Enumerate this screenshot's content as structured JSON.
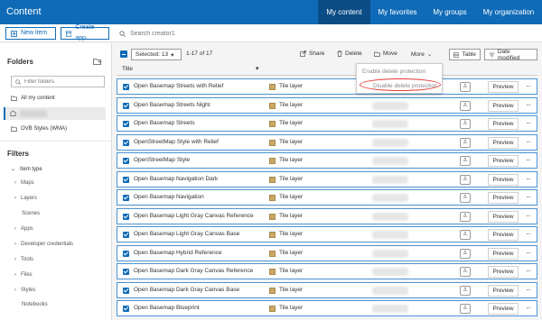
{
  "app": {
    "title": "Content",
    "tabs": [
      {
        "label": "My content",
        "active": true
      },
      {
        "label": "My favorites",
        "active": false
      },
      {
        "label": "My groups",
        "active": false
      },
      {
        "label": "My organization",
        "active": false
      }
    ]
  },
  "toolbar": {
    "new_item": "New item",
    "create_app": "Create app",
    "search_placeholder": "Search creator1"
  },
  "folders": {
    "heading": "Folders",
    "filter_placeholder": "Filter folders",
    "items": [
      {
        "label": "All my content"
      },
      {
        "label": "OVB Styles (WMA)"
      }
    ]
  },
  "filters": {
    "heading": "Filters",
    "group": "Item type",
    "items": [
      {
        "label": "Maps",
        "expandable": true
      },
      {
        "label": "Layers",
        "expandable": true
      },
      {
        "label": "Scenes",
        "expandable": false
      },
      {
        "label": "Apps",
        "expandable": true
      },
      {
        "label": "Developer credentials",
        "expandable": true
      },
      {
        "label": "Tools",
        "expandable": true
      },
      {
        "label": "Files",
        "expandable": true
      },
      {
        "label": "Styles",
        "expandable": true
      },
      {
        "label": "Notebooks",
        "expandable": false
      }
    ]
  },
  "selection": {
    "selected_label": "Selected: 13",
    "range": "1-17 of 17",
    "share": "Share",
    "delete": "Delete",
    "move": "Move",
    "more": "More",
    "table": "Table",
    "date_modified": "Date modified"
  },
  "table": {
    "title_header": "Title",
    "rows": [
      {
        "name": "Open Basemap Streets with Relief",
        "type": "Tile layer"
      },
      {
        "name": "Open Basemap Streets Night",
        "type": "Tile layer"
      },
      {
        "name": "Open Basemap Streets",
        "type": "Tile layer"
      },
      {
        "name": "OpenStreetMap Style with Relief",
        "type": "Tile layer"
      },
      {
        "name": "OpenStreetMap Style",
        "type": "Tile layer"
      },
      {
        "name": "Open Basemap Navigation Dark",
        "type": "Tile layer"
      },
      {
        "name": "Open Basemap Navigation",
        "type": "Tile layer"
      },
      {
        "name": "Open Basemap Light Gray Canvas Reference",
        "type": "Tile layer"
      },
      {
        "name": "Open Basemap Light Gray Canvas Base",
        "type": "Tile layer"
      },
      {
        "name": "Open Basemap Hybrid Reference",
        "type": "Tile layer"
      },
      {
        "name": "Open Basemap Dark Gray Canvas Reference",
        "type": "Tile layer"
      },
      {
        "name": "Open Basemap Dark Gray Canvas Base",
        "type": "Tile layer"
      },
      {
        "name": "Open Basemap Blueprint",
        "type": "Tile layer"
      }
    ],
    "preview_label": "Preview"
  },
  "more_menu": {
    "enable": "Enable delete protection",
    "disable": "Disable delete protection"
  },
  "colors": {
    "brand": "#0f6bb7",
    "highlight": "#e53935"
  }
}
